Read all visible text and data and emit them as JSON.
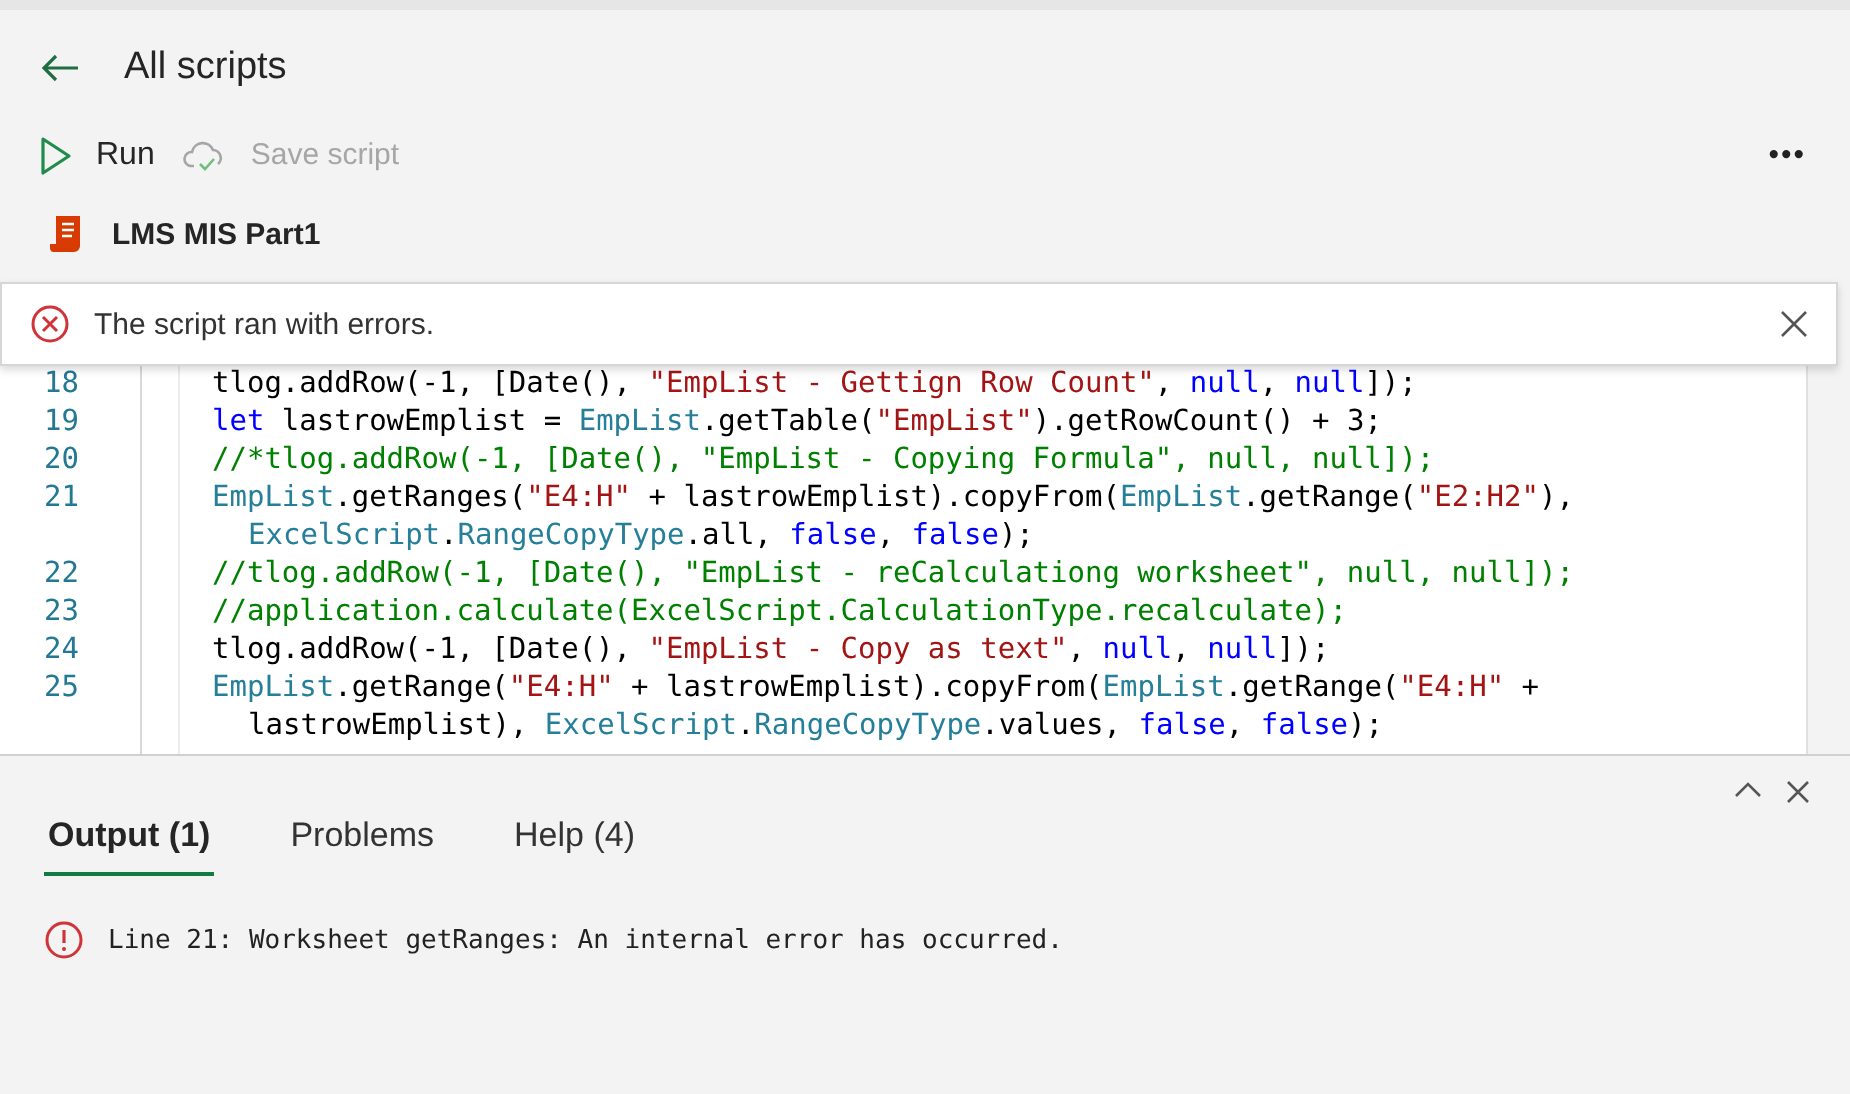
{
  "header": {
    "back_label": "All scripts",
    "toolbar": [
      {
        "kind": "run",
        "label": "Run",
        "disabled": false
      },
      {
        "kind": "save",
        "label": "Save script",
        "disabled": true
      }
    ],
    "more": "•••",
    "script_name": "LMS MIS Part1"
  },
  "banner": {
    "message": "The script ran with errors."
  },
  "code": {
    "lines": [
      {
        "number": "18",
        "parts": [
          [
            {
              "kind": "plain",
              "text": "tlog.addRow(-1, [Date(), "
            },
            {
              "kind": "string",
              "text": "\"EmpList - Gettign Row Count\""
            },
            {
              "kind": "plain",
              "text": ", "
            },
            {
              "kind": "keyword",
              "text": "null"
            },
            {
              "kind": "plain",
              "text": ", "
            },
            {
              "kind": "keyword",
              "text": "null"
            },
            {
              "kind": "plain",
              "text": "]);"
            }
          ]
        ]
      },
      {
        "number": "19",
        "parts": [
          [
            {
              "kind": "keyword",
              "text": "let"
            },
            {
              "kind": "plain",
              "text": " lastrowEmplist = "
            },
            {
              "kind": "type",
              "text": "EmpList"
            },
            {
              "kind": "plain",
              "text": ".getTable("
            },
            {
              "kind": "string",
              "text": "\"EmpList\""
            },
            {
              "kind": "plain",
              "text": ").getRowCount() + 3;"
            }
          ]
        ]
      },
      {
        "number": "20",
        "parts": [
          [
            {
              "kind": "comment",
              "text": "//*tlog.addRow(-1, [Date(), \"EmpList - Copying Formula\", null, null]);"
            }
          ]
        ]
      },
      {
        "number": "21",
        "parts": [
          [
            {
              "kind": "type",
              "text": "EmpList"
            },
            {
              "kind": "plain",
              "text": ".getRanges("
            },
            {
              "kind": "string",
              "text": "\"E4:H\""
            },
            {
              "kind": "plain",
              "text": " + lastrowEmplist).copyFrom("
            },
            {
              "kind": "type",
              "text": "EmpList"
            },
            {
              "kind": "plain",
              "text": ".getRange("
            },
            {
              "kind": "string",
              "text": "\"E2:H2\""
            },
            {
              "kind": "plain",
              "text": "),"
            }
          ],
          [
            {
              "kind": "type",
              "text": "ExcelScript"
            },
            {
              "kind": "plain",
              "text": "."
            },
            {
              "kind": "type",
              "text": "RangeCopyType"
            },
            {
              "kind": "plain",
              "text": ".all, "
            },
            {
              "kind": "keyword",
              "text": "false"
            },
            {
              "kind": "plain",
              "text": ", "
            },
            {
              "kind": "keyword",
              "text": "false"
            },
            {
              "kind": "plain",
              "text": ");"
            }
          ]
        ]
      },
      {
        "number": "22",
        "parts": [
          [
            {
              "kind": "comment",
              "text": "//tlog.addRow(-1, [Date(), \"EmpList - reCalculationg worksheet\", null, null]);"
            }
          ]
        ]
      },
      {
        "number": "23",
        "parts": [
          [
            {
              "kind": "comment",
              "text": "//application.calculate(ExcelScript.CalculationType.recalculate);"
            }
          ]
        ]
      },
      {
        "number": "24",
        "parts": [
          [
            {
              "kind": "plain",
              "text": "tlog.addRow(-1, [Date(), "
            },
            {
              "kind": "string",
              "text": "\"EmpList - Copy as text\""
            },
            {
              "kind": "plain",
              "text": ", "
            },
            {
              "kind": "keyword",
              "text": "null"
            },
            {
              "kind": "plain",
              "text": ", "
            },
            {
              "kind": "keyword",
              "text": "null"
            },
            {
              "kind": "plain",
              "text": "]);"
            }
          ]
        ]
      },
      {
        "number": "25",
        "parts": [
          [
            {
              "kind": "type",
              "text": "EmpList"
            },
            {
              "kind": "plain",
              "text": ".getRange("
            },
            {
              "kind": "string",
              "text": "\"E4:H\""
            },
            {
              "kind": "plain",
              "text": " + lastrowEmplist).copyFrom("
            },
            {
              "kind": "type",
              "text": "EmpList"
            },
            {
              "kind": "plain",
              "text": ".getRange("
            },
            {
              "kind": "string",
              "text": "\"E4:H\""
            },
            {
              "kind": "plain",
              "text": " +"
            }
          ],
          [
            {
              "kind": "plain",
              "text": "lastrowEmplist), "
            },
            {
              "kind": "type",
              "text": "ExcelScript"
            },
            {
              "kind": "plain",
              "text": "."
            },
            {
              "kind": "type",
              "text": "RangeCopyType"
            },
            {
              "kind": "plain",
              "text": ".values, "
            },
            {
              "kind": "keyword",
              "text": "false"
            },
            {
              "kind": "plain",
              "text": ", "
            },
            {
              "kind": "keyword",
              "text": "false"
            },
            {
              "kind": "plain",
              "text": ");"
            }
          ]
        ]
      }
    ]
  },
  "output_panel": {
    "tabs": [
      {
        "label": "Output (1)",
        "selected": true
      },
      {
        "label": "Problems",
        "selected": false
      },
      {
        "label": "Help (4)",
        "selected": false
      }
    ],
    "messages": [
      {
        "text": "Line 21: Worksheet getRanges: An internal error has occurred."
      }
    ]
  }
}
